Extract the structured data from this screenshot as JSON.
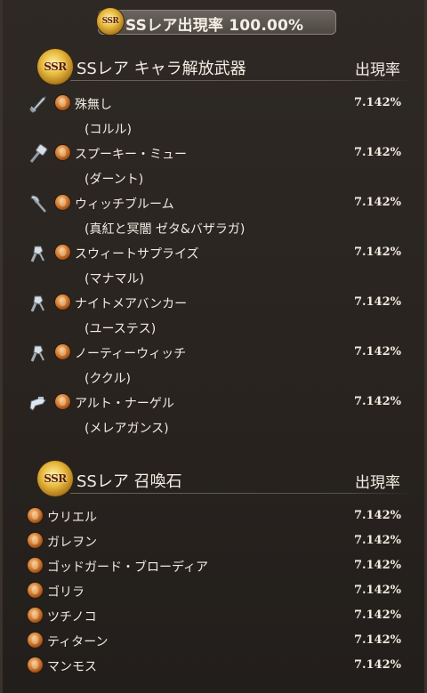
{
  "summary": {
    "text": "SSレア出現率 100.00%",
    "badge": "SSR"
  },
  "weapons_section": {
    "badge": "SSR",
    "title": "SSレア キャラ解放武器",
    "rate_header": "出現率",
    "items": [
      {
        "name": "殊無し",
        "character": "(コルル)",
        "rate": "7.142%",
        "icon": "sword-icon"
      },
      {
        "name": "スプーキー・ミュー",
        "character": "(ダーント)",
        "rate": "7.142%",
        "icon": "hammer-icon"
      },
      {
        "name": "ウィッチブルーム",
        "character": "(真紅と冥闇 ゼタ&バザラガ)",
        "rate": "7.142%",
        "icon": "axe-icon"
      },
      {
        "name": "スウィートサプライズ",
        "character": "(マナマル)",
        "rate": "7.142%",
        "icon": "fist-icon"
      },
      {
        "name": "ナイトメアバンカー",
        "character": "(ユーステス)",
        "rate": "7.142%",
        "icon": "fist-icon"
      },
      {
        "name": "ノーティーウィッチ",
        "character": "(ククル)",
        "rate": "7.142%",
        "icon": "fist-icon"
      },
      {
        "name": "アルト・ナーゲル",
        "character": "(メレアガンス)",
        "rate": "7.142%",
        "icon": "gun-icon"
      }
    ]
  },
  "summons_section": {
    "badge": "SSR",
    "title": "SSレア 召喚石",
    "rate_header": "出現率",
    "items": [
      {
        "name": "ウリエル",
        "rate": "7.142%"
      },
      {
        "name": "ガレヲン",
        "rate": "7.142%"
      },
      {
        "name": "ゴッドガード・ブローディア",
        "rate": "7.142%"
      },
      {
        "name": "ゴリラ",
        "rate": "7.142%"
      },
      {
        "name": "ツチノコ",
        "rate": "7.142%"
      },
      {
        "name": "ティターン",
        "rate": "7.142%"
      },
      {
        "name": "マンモス",
        "rate": "7.142%"
      }
    ]
  }
}
